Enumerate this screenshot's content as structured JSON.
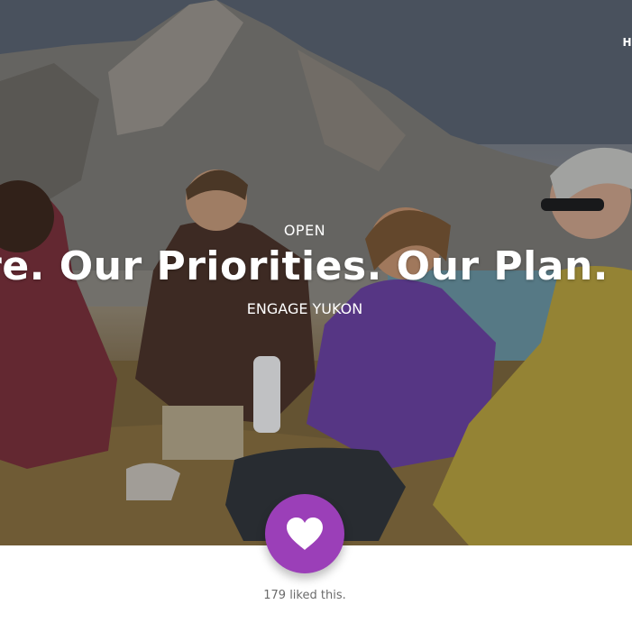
{
  "nav": {
    "fragment": "H"
  },
  "hero": {
    "status_label": "OPEN",
    "headline": "Yukon's Future. Our Priorities. Our Plan.",
    "category_label": "ENGAGE YUKON"
  },
  "like": {
    "icon": "heart-icon",
    "count_text": "179 liked this."
  },
  "colors": {
    "accent": "#9b3fb8",
    "text_muted": "#6b6b6b"
  }
}
